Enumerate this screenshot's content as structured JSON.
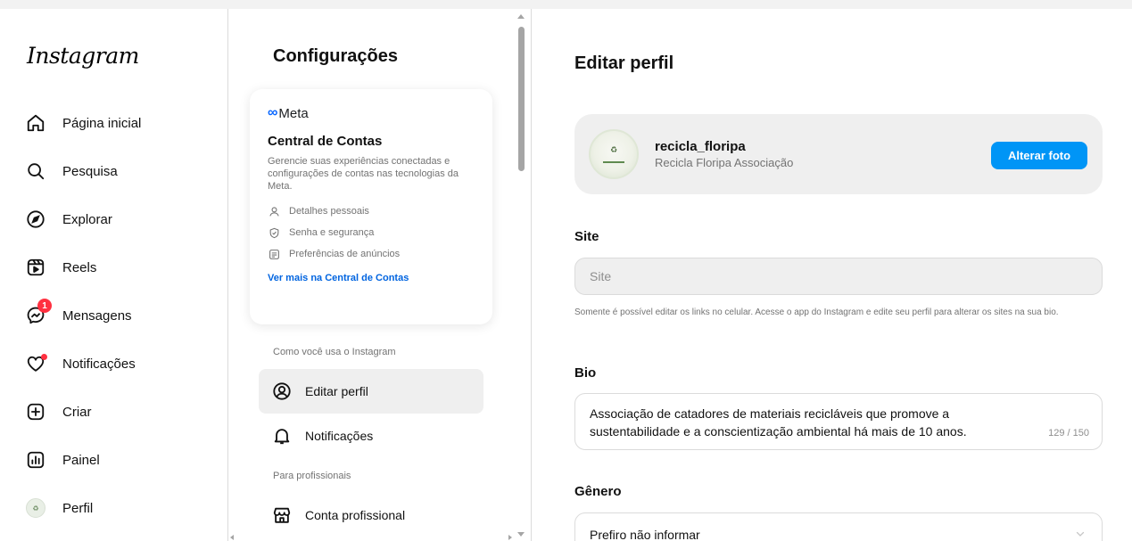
{
  "nav": {
    "logo": "Instagram",
    "items": [
      {
        "label": "Página inicial",
        "icon": "home-icon"
      },
      {
        "label": "Pesquisa",
        "icon": "search-icon"
      },
      {
        "label": "Explorar",
        "icon": "compass-icon"
      },
      {
        "label": "Reels",
        "icon": "reels-icon"
      },
      {
        "label": "Mensagens",
        "icon": "messenger-icon",
        "badge": "1"
      },
      {
        "label": "Notificações",
        "icon": "heart-icon"
      },
      {
        "label": "Criar",
        "icon": "plus-square-icon"
      },
      {
        "label": "Painel",
        "icon": "dashboard-icon"
      },
      {
        "label": "Perfil",
        "icon": "avatar-icon"
      }
    ]
  },
  "settings": {
    "title": "Configurações",
    "meta_card": {
      "brand": "Meta",
      "title": "Central de Contas",
      "description": "Gerencie suas experiências conectadas e configurações de contas nas tecnologias da Meta.",
      "rows": [
        {
          "label": "Detalhes pessoais",
          "icon": "person-icon"
        },
        {
          "label": "Senha e segurança",
          "icon": "shield-icon"
        },
        {
          "label": "Preferências de anúncios",
          "icon": "ad-preferences-icon"
        }
      ],
      "link": "Ver mais na Central de Contas"
    },
    "section_usage": "Como você usa o Instagram",
    "items_usage": [
      {
        "label": "Editar perfil",
        "icon": "user-circle-icon",
        "active": true
      },
      {
        "label": "Notificações",
        "icon": "bell-icon",
        "active": false
      }
    ],
    "section_pro": "Para profissionais",
    "items_pro": [
      {
        "label": "Conta profissional",
        "icon": "store-icon"
      }
    ]
  },
  "main": {
    "title": "Editar perfil",
    "profile": {
      "username": "recicla_floripa",
      "full_name": "Recicla Floripa Associação",
      "change_photo": "Alterar foto"
    },
    "site": {
      "label": "Site",
      "placeholder": "Site",
      "help": "Somente é possível editar os links no celular. Acesse o app do Instagram e edite seu perfil para alterar os sites na sua bio."
    },
    "bio": {
      "label": "Bio",
      "text": "Associação de catadores de materiais recicláveis que promove a sustentabilidade e a conscientização ambiental há mais de 10 anos.",
      "counter": "129 / 150"
    },
    "gender": {
      "label": "Gênero",
      "value": "Prefiro não informar"
    }
  },
  "colors": {
    "primary_button": "#0095f6",
    "meta_link": "#0064e0",
    "badge": "#ff3040",
    "active_item_bg": "#efefef"
  }
}
